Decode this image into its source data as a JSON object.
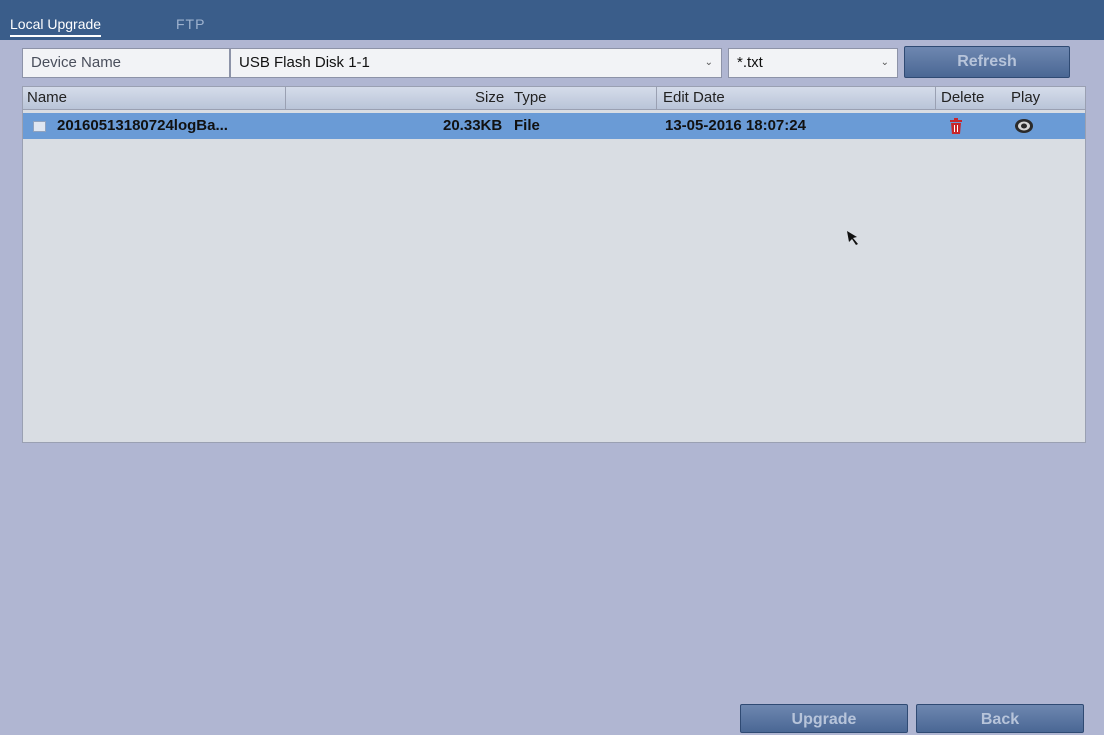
{
  "tabs": [
    {
      "label": "Local Upgrade",
      "active": true
    },
    {
      "label": "FTP",
      "active": false
    }
  ],
  "device": {
    "label": "Device Name",
    "value": "USB Flash Disk 1-1",
    "filter": "*.txt"
  },
  "buttons": {
    "refresh": "Refresh",
    "upgrade": "Upgrade",
    "back": "Back"
  },
  "table": {
    "columns": [
      "Name",
      "Size",
      "Type",
      "Edit Date",
      "Delete",
      "Play"
    ],
    "rows": [
      {
        "name": "20160513180724logBa...",
        "size": "20.33KB",
        "type": "File",
        "edit_date": "13-05-2016 18:07:24",
        "icons": {
          "file": "file-icon",
          "delete": "trash-icon",
          "play": "play-icon"
        }
      }
    ]
  },
  "colors": {
    "header_bar": "#3a5d8a",
    "selected_row": "#6a9bd6",
    "delete_icon": "#c8262b"
  }
}
